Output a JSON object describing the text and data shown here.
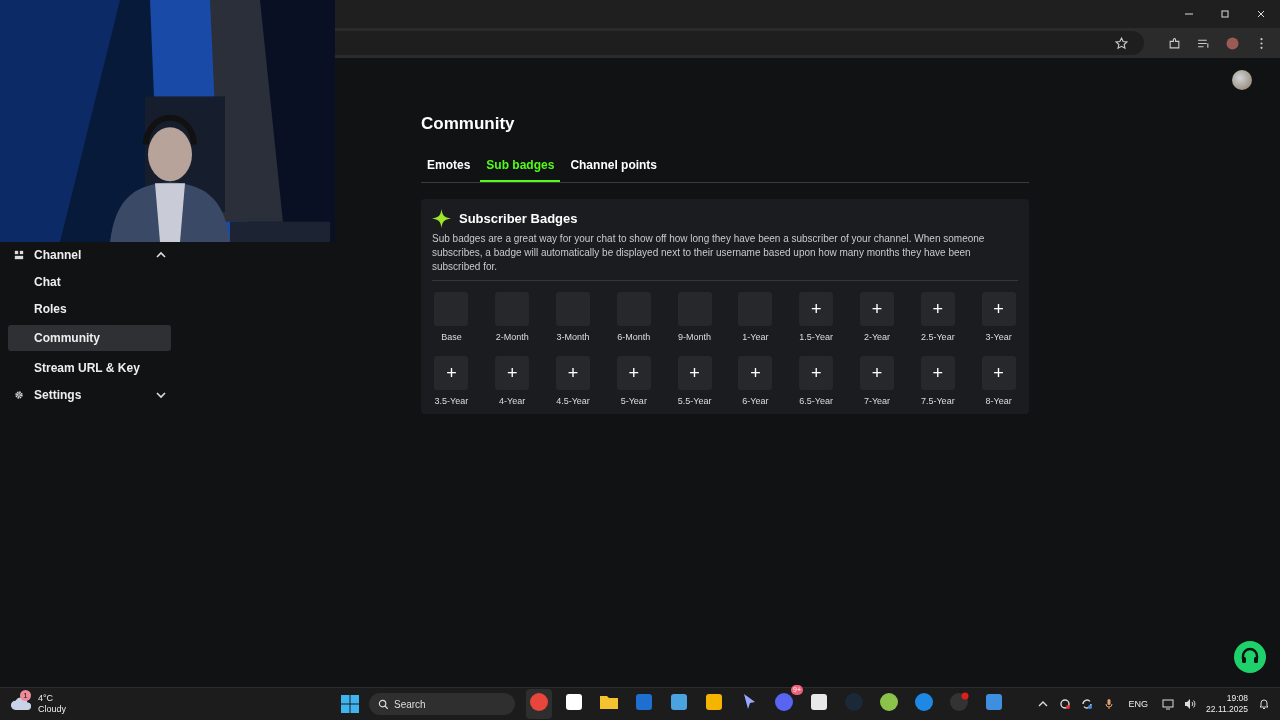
{
  "sidebar": {
    "items": [
      {
        "label": "Channel",
        "kind": "group",
        "expanded": true
      },
      {
        "label": "Chat",
        "kind": "link",
        "selected": false
      },
      {
        "label": "Roles",
        "kind": "link",
        "selected": false
      },
      {
        "label": "Community",
        "kind": "link",
        "selected": true
      },
      {
        "label": "Stream URL & Key",
        "kind": "link",
        "selected": false
      },
      {
        "label": "Settings",
        "kind": "group",
        "expanded": false
      }
    ]
  },
  "page": {
    "title": "Community",
    "tabs": [
      {
        "label": "Emotes",
        "selected": false
      },
      {
        "label": "Sub badges",
        "selected": true
      },
      {
        "label": "Channel points",
        "selected": false
      }
    ],
    "card": {
      "title": "Subscriber Badges",
      "description": "Sub badges are a great way for your chat to show off how long they have been a subscriber of your channel. When someone subscribes, a badge will automatically be displayed next to their username based upon how many months they have been subscribed for.",
      "badges": [
        {
          "label": "Base",
          "kind": "empty"
        },
        {
          "label": "2-Month",
          "kind": "empty"
        },
        {
          "label": "3-Month",
          "kind": "empty"
        },
        {
          "label": "6-Month",
          "kind": "empty"
        },
        {
          "label": "9-Month",
          "kind": "empty"
        },
        {
          "label": "1-Year",
          "kind": "empty"
        },
        {
          "label": "1.5-Year",
          "kind": "add",
          "action": "+"
        },
        {
          "label": "2-Year",
          "kind": "add",
          "action": "+"
        },
        {
          "label": "2.5-Year",
          "kind": "add",
          "action": "+"
        },
        {
          "label": "3-Year",
          "kind": "add",
          "action": "+"
        },
        {
          "label": "3.5-Year",
          "kind": "add",
          "action": "+"
        },
        {
          "label": "4-Year",
          "kind": "add",
          "action": "+"
        },
        {
          "label": "4.5-Year",
          "kind": "add",
          "action": "+"
        },
        {
          "label": "5-Year",
          "kind": "add",
          "action": "+"
        },
        {
          "label": "5.5-Year",
          "kind": "add",
          "action": "+"
        },
        {
          "label": "6-Year",
          "kind": "add",
          "action": "+"
        },
        {
          "label": "6.5-Year",
          "kind": "add",
          "action": "+"
        },
        {
          "label": "7-Year",
          "kind": "add",
          "action": "+"
        },
        {
          "label": "7.5-Year",
          "kind": "add",
          "action": "+"
        },
        {
          "label": "8-Year",
          "kind": "add",
          "action": "+"
        }
      ]
    }
  },
  "taskbar": {
    "weather": {
      "badge": "1",
      "temperature": "4°C",
      "condition": "Cloudy"
    },
    "search": {
      "placeholder": "Search"
    },
    "chat_badge": "9+",
    "language": "ENG",
    "time": "19:08",
    "date": "22.11.2025"
  }
}
